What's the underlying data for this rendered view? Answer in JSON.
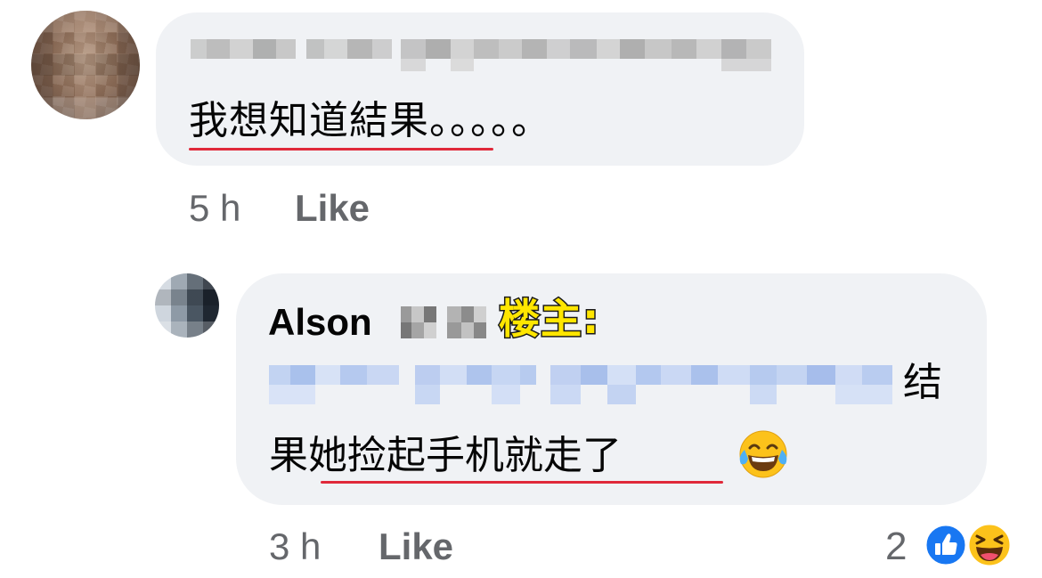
{
  "comment": {
    "author_redacted": true,
    "text": "我想知道結果。。。。。",
    "time": "5 h",
    "like_label": "Like"
  },
  "reply": {
    "author": "Alson",
    "op_tag": "楼主:",
    "mention_redacted": true,
    "text_line1": "结",
    "text_line2": "果她捡起手机就走了",
    "time": "3 h",
    "like_label": "Like",
    "reaction_count": "2",
    "reactions": [
      "like-icon",
      "haha-icon"
    ],
    "inline_emoji": "tears-of-joy-emoji"
  },
  "colors": {
    "bubble": "#f0f2f5",
    "meta_text": "#65676b",
    "underline": "#e0293a",
    "op_tag_fill": "#ffe600",
    "like_blue": "#1877f2"
  }
}
